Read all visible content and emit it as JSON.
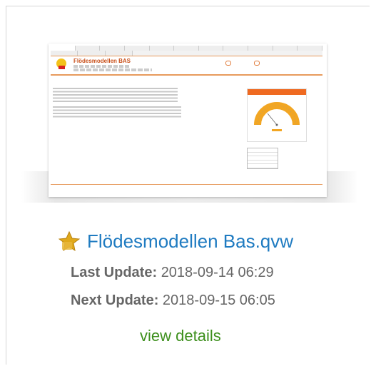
{
  "document": {
    "title": "Flödesmodellen Bas.qvw",
    "last_update_label": "Last Update:",
    "last_update_value": "2018-09-14 06:29",
    "next_update_label": "Next Update:",
    "next_update_value": "2018-09-15 06:05",
    "view_details_label": "view details",
    "icon": "favorite-star-icon",
    "colors": {
      "title": "#1f7bc1",
      "link": "#3d8f1c",
      "star": "#e0a91b",
      "meta": "#666666"
    }
  },
  "thumbnail": {
    "title": "Flödesmodellen BAS",
    "colors": {
      "accent": "#ef6a21",
      "gauge_fill": "#f2a623"
    }
  }
}
